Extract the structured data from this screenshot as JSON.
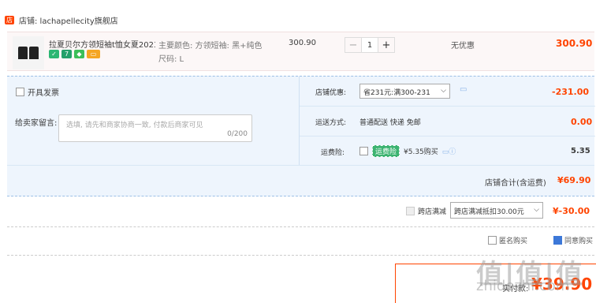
{
  "shop": {
    "label": "店铺: lachapellecity旗舰店"
  },
  "item": {
    "title": "拉夏贝尔方领短袖t恤女夏2023...",
    "sku_color": "主要颜色: 方领短袖: 黑+纯色",
    "sku_size": "尺码: L",
    "unit_price": "300.90",
    "quantity": "1",
    "promo": "无优惠",
    "subtotal": "300.90",
    "minus": "−",
    "plus": "+"
  },
  "options": {
    "invoice_label": "开具发票",
    "message_label": "给卖家留言:",
    "message_placeholder": "选填, 请先和商家协商一致, 付款后商家可见",
    "message_count": "0/200",
    "discount_label": "店铺优惠:",
    "discount_select": "省231元:满300-231",
    "discount_value": "-231.00",
    "shipping_label": "运送方式:",
    "shipping_value": "普通配送 快递 免邮",
    "shipping_fee": "0.00",
    "insurance_label": "运费险:",
    "insurance_tag": "运费险",
    "insurance_text": "¥5.35购买",
    "insurance_fee": "5.35",
    "total_label": "店铺合计(含运费)",
    "total_value": "¥69.90"
  },
  "cross": {
    "label": "跨店满减",
    "select": "跨店满减抵扣30.00元",
    "value": "¥-30.00"
  },
  "footer": {
    "anon_label": "匿名购买",
    "fb_label": "同意购买",
    "pay_label": "实付款:",
    "pay_value": "¥39.90",
    "watermark": "值|值|值",
    "watermark2": "zhidezhi.com"
  },
  "colors": {
    "accent": "#ff4400",
    "panel": "#eef5fd"
  }
}
